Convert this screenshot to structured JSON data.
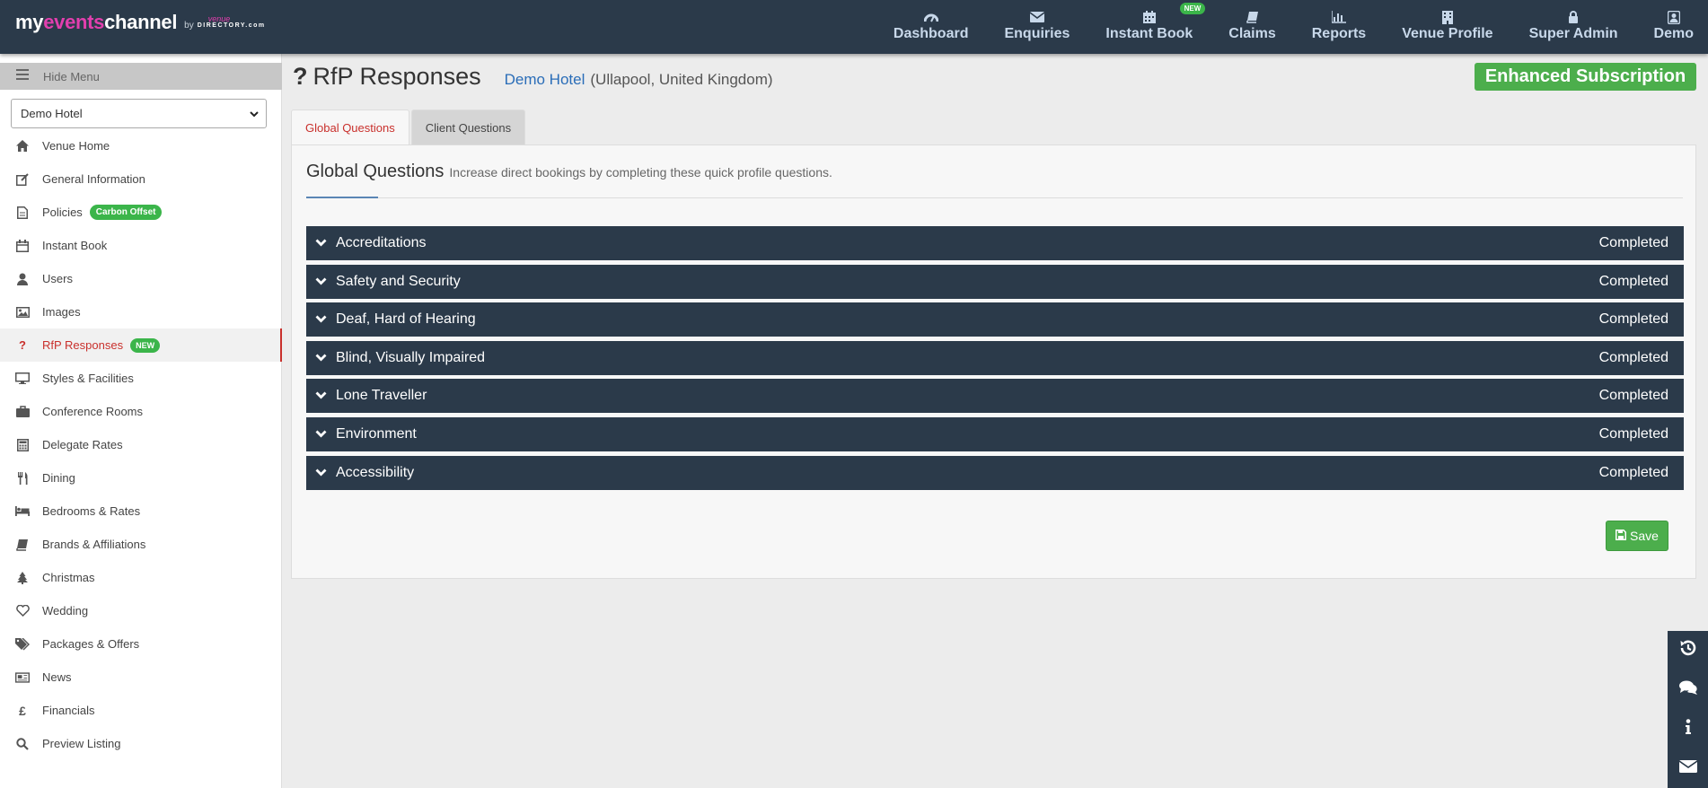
{
  "logo": {
    "part1": "my",
    "part2": "events",
    "part3": "channel",
    "by": "by",
    "venue": "venue",
    "directory": "DIRECTORY",
    "dotcom": ".com"
  },
  "nav": [
    {
      "label": "Dashboard",
      "icon": "dashboard-icon"
    },
    {
      "label": "Enquiries",
      "icon": "envelope-icon"
    },
    {
      "label": "Instant Book",
      "icon": "calendar-icon",
      "badge": "NEW"
    },
    {
      "label": "Claims",
      "icon": "book-icon"
    },
    {
      "label": "Reports",
      "icon": "bar-chart-icon"
    },
    {
      "label": "Venue Profile",
      "icon": "building-icon"
    },
    {
      "label": "Super Admin",
      "icon": "lock-icon"
    },
    {
      "label": "Demo",
      "icon": "user-icon"
    }
  ],
  "sidebar": {
    "hide_menu": "Hide Menu",
    "venue_select": "Demo Hotel",
    "items": [
      {
        "label": "Venue Home",
        "icon": "home-icon"
      },
      {
        "label": "General Information",
        "icon": "edit-icon"
      },
      {
        "label": "Policies",
        "icon": "document-icon",
        "badge": "Carbon Offset"
      },
      {
        "label": "Instant Book",
        "icon": "calendar-icon"
      },
      {
        "label": "Users",
        "icon": "user-icon"
      },
      {
        "label": "Images",
        "icon": "image-icon"
      },
      {
        "label": "RfP Responses",
        "icon": "question-icon",
        "badge": "NEW",
        "active": true
      },
      {
        "label": "Styles & Facilities",
        "icon": "monitor-icon"
      },
      {
        "label": "Conference Rooms",
        "icon": "briefcase-icon"
      },
      {
        "label": "Delegate Rates",
        "icon": "calculator-icon"
      },
      {
        "label": "Dining",
        "icon": "cutlery-icon"
      },
      {
        "label": "Bedrooms & Rates",
        "icon": "bed-icon"
      },
      {
        "label": "Brands & Affiliations",
        "icon": "book-icon"
      },
      {
        "label": "Christmas",
        "icon": "tree-icon"
      },
      {
        "label": "Wedding",
        "icon": "heart-icon"
      },
      {
        "label": "Packages & Offers",
        "icon": "tags-icon"
      },
      {
        "label": "News",
        "icon": "newspaper-icon"
      },
      {
        "label": "Financials",
        "icon": "pound-icon"
      },
      {
        "label": "Preview Listing",
        "icon": "search-icon"
      }
    ]
  },
  "page": {
    "title_icon": "?",
    "title": "RfP Responses",
    "hotel": "Demo Hotel",
    "location": "(Ullapool, United Kingdom)",
    "subscription": "Enhanced Subscription"
  },
  "tabs": [
    {
      "label": "Global Questions",
      "active": true
    },
    {
      "label": "Client Questions",
      "active": false
    }
  ],
  "panel": {
    "heading": "Global Questions",
    "description": "Increase direct bookings by completing these quick profile questions."
  },
  "accordions": [
    {
      "title": "Accreditations",
      "status": "Completed"
    },
    {
      "title": "Safety and Security",
      "status": "Completed"
    },
    {
      "title": "Deaf, Hard of Hearing",
      "status": "Completed"
    },
    {
      "title": "Blind, Visually Impaired",
      "status": "Completed"
    },
    {
      "title": "Lone Traveller",
      "status": "Completed"
    },
    {
      "title": "Environment",
      "status": "Completed"
    },
    {
      "title": "Accessibility",
      "status": "Completed"
    }
  ],
  "save_label": "Save",
  "float_tools": [
    {
      "icon": "history-icon"
    },
    {
      "icon": "chat-icon"
    },
    {
      "icon": "info-icon"
    },
    {
      "icon": "mail-icon"
    }
  ],
  "colors": {
    "topbar": "#2b3a4a",
    "accent_red": "#c9302c",
    "green": "#4cae4c",
    "link_blue": "#2a6db8"
  }
}
